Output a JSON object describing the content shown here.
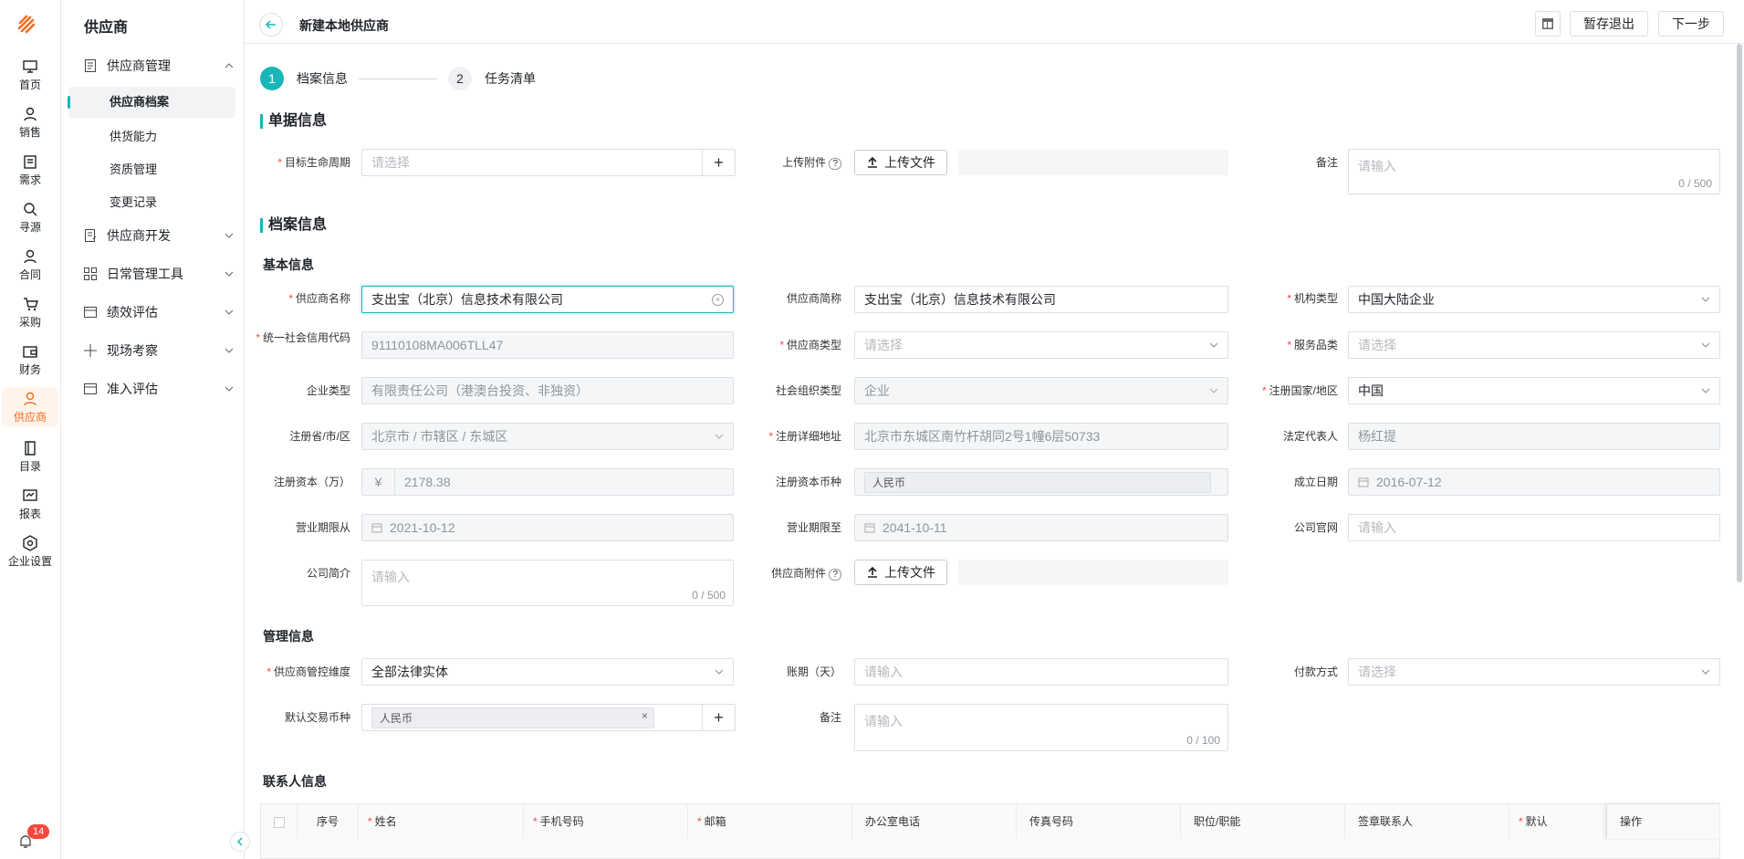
{
  "rail": {
    "items": [
      {
        "label": "首页",
        "icon": "monitor-icon"
      },
      {
        "label": "销售",
        "icon": "person-icon"
      },
      {
        "label": "需求",
        "icon": "clipboard-icon"
      },
      {
        "label": "寻源",
        "icon": "search-icon"
      },
      {
        "label": "合同",
        "icon": "person-icon"
      },
      {
        "label": "采购",
        "icon": "cart-icon"
      },
      {
        "label": "财务",
        "icon": "wallet-icon"
      },
      {
        "label": "供应商",
        "icon": "person-icon",
        "active": true
      },
      {
        "label": "目录",
        "icon": "book-icon"
      },
      {
        "label": "报表",
        "icon": "report-icon"
      },
      {
        "label": "企业设置",
        "icon": "hexagon-icon"
      }
    ],
    "notification_count": "14"
  },
  "subnav": {
    "title": "供应商",
    "groups": [
      {
        "label": "供应商管理",
        "icon": "document-icon",
        "expanded": true,
        "children": [
          "供应商档案",
          "供货能力",
          "资质管理",
          "变更记录"
        ]
      },
      {
        "label": "供应商开发",
        "icon": "edit-doc-icon"
      },
      {
        "label": "日常管理工具",
        "icon": "grid-icon"
      },
      {
        "label": "绩效评估",
        "icon": "card-icon"
      },
      {
        "label": "现场考察",
        "icon": "plus-icon"
      },
      {
        "label": "准入评估",
        "icon": "card-icon"
      }
    ],
    "active_child": "供应商档案"
  },
  "header": {
    "title": "新建本地供应商",
    "save_exit": "暂存退出",
    "next": "下一步"
  },
  "steps": [
    {
      "num": "1",
      "label": "档案信息",
      "active": true
    },
    {
      "num": "2",
      "label": "任务清单",
      "active": false
    }
  ],
  "bill": {
    "title": "单据信息",
    "lifecycle_label": "目标生命周期",
    "lifecycle_ph": "请选择",
    "attach_label": "上传附件",
    "upload_btn": "上传文件",
    "remark_label": "备注",
    "remark_ph": "请输入",
    "remark_count": "0 / 500"
  },
  "archive": {
    "title": "档案信息",
    "basic_title": "基本信息",
    "fields": {
      "supplier_name": {
        "label": "供应商名称",
        "value": "支出宝（北京）信息技术有限公司"
      },
      "supplier_short": {
        "label": "供应商简称",
        "value": "支出宝（北京）信息技术有限公司"
      },
      "org_type": {
        "label": "机构类型",
        "value": "中国大陆企业"
      },
      "credit_code": {
        "label": "统一社会信用代码",
        "value": "91110108MA006TLL47"
      },
      "supplier_type": {
        "label": "供应商类型",
        "ph": "请选择"
      },
      "service_cat": {
        "label": "服务品类",
        "ph": "请选择"
      },
      "enterprise_type": {
        "label": "企业类型",
        "value": "有限责任公司（港澳台投资、非独资）"
      },
      "social_org_type": {
        "label": "社会组织类型",
        "value": "企业"
      },
      "reg_country": {
        "label": "注册国家/地区",
        "value": "中国"
      },
      "reg_province": {
        "label": "注册省/市/区",
        "value": "北京市 / 市辖区 / 东城区"
      },
      "reg_address": {
        "label": "注册详细地址",
        "value": "北京市东城区南竹杆胡同2号1幢6层50733"
      },
      "legal_rep": {
        "label": "法定代表人",
        "value": "杨红提"
      },
      "reg_capital": {
        "label": "注册资本（万）",
        "prefix": "¥",
        "value": "2178.38"
      },
      "capital_currency": {
        "label": "注册资本币种",
        "value": "人民币"
      },
      "found_date": {
        "label": "成立日期",
        "value": "2016-07-12"
      },
      "biz_from": {
        "label": "营业期限从",
        "value": "2021-10-12"
      },
      "biz_to": {
        "label": "营业期限至",
        "value": "2041-10-11"
      },
      "website": {
        "label": "公司官网",
        "ph": "请输入"
      },
      "intro": {
        "label": "公司简介",
        "ph": "请输入",
        "count": "0 / 500"
      },
      "supplier_attach": {
        "label": "供应商附件",
        "btn": "上传文件"
      }
    }
  },
  "mgmt": {
    "title": "管理信息",
    "control_dim": {
      "label": "供应商管控维度",
      "value": "全部法律实体"
    },
    "period": {
      "label": "账期（天）",
      "ph": "请输入"
    },
    "pay_method": {
      "label": "付款方式",
      "ph": "请选择"
    },
    "currency": {
      "label": "默认交易币种",
      "value": "人民币"
    },
    "remark": {
      "label": "备注",
      "ph": "请输入",
      "count": "0 / 100"
    }
  },
  "contacts": {
    "title": "联系人信息",
    "columns": [
      "序号",
      "姓名",
      "手机号码",
      "邮箱",
      "办公室电话",
      "传真号码",
      "职位/职能",
      "签章联系人",
      "默认",
      "操作"
    ]
  },
  "colors": {
    "accent": "#1ab5b8",
    "brand": "#f56b1c",
    "required": "#f5493d"
  }
}
